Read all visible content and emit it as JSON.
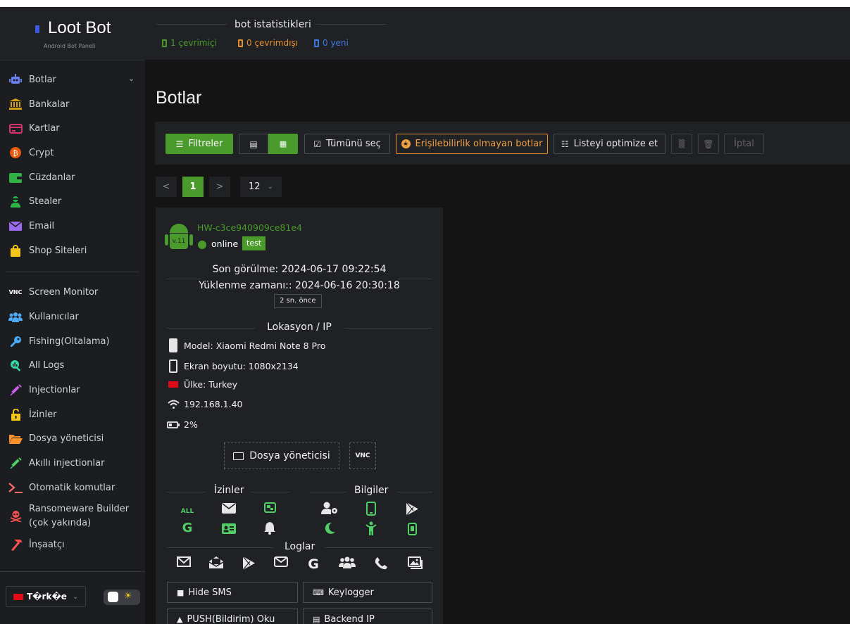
{
  "brand": {
    "name": "Loot Bot",
    "subtitle": "Android Bot Paneli"
  },
  "sidebar": {
    "items": [
      {
        "label": "Botlar",
        "icon": "robot-icon",
        "color": "#6a7ff0"
      },
      {
        "label": "Bankalar",
        "icon": "bank-icon",
        "color": "#d4a017"
      },
      {
        "label": "Kartlar",
        "icon": "credit-card-icon",
        "color": "#d6336c"
      },
      {
        "label": "Crypt",
        "icon": "bitcoin-icon",
        "color": "#e8590c"
      },
      {
        "label": "Cüzdanlar",
        "icon": "wallet-icon",
        "color": "#2fb344"
      },
      {
        "label": "Stealer",
        "icon": "user-secret-icon",
        "color": "#2fb344"
      },
      {
        "label": "Email",
        "icon": "envelope-icon",
        "color": "#9b6bf0"
      },
      {
        "label": "Shop Siteleri",
        "icon": "shopping-bag-icon",
        "color": "#f5c518"
      },
      {
        "label": "Screen Monitor",
        "icon": "vnc-icon",
        "color": "#ffffff"
      },
      {
        "label": "Kullanıcılar",
        "icon": "users-icon",
        "color": "#4dabf7"
      },
      {
        "label": "Fishing(Oltalama)",
        "icon": "key-icon",
        "color": "#4dabf7"
      },
      {
        "label": "All Logs",
        "icon": "search-chart-icon",
        "color": "#38d9a9"
      },
      {
        "label": "Injectionlar",
        "icon": "syringe-icon",
        "color": "#cc5de8"
      },
      {
        "label": "İzinler",
        "icon": "unlock-icon",
        "color": "#f5c518"
      },
      {
        "label": "Dosya yöneticisi",
        "icon": "folder-open-icon",
        "color": "#ff922b"
      },
      {
        "label": "Akıllı injectionlar",
        "icon": "syringe-icon",
        "color": "#51cf66"
      },
      {
        "label": "Otomatik komutlar",
        "icon": "terminal-icon",
        "color": "#ff6b6b"
      },
      {
        "label": "Ransomeware Builder (çok yakında)",
        "icon": "skull-icon",
        "color": "#fa5252"
      },
      {
        "label": "İnşaatçı",
        "icon": "hammer-icon",
        "color": "#fa5252"
      }
    ],
    "language": "T�rk�e",
    "accent": "#4a9a2c"
  },
  "header": {
    "stats_title": "bot istatistikleri",
    "online": "1 çevrimiçi",
    "offline": "0 çevrimdışı",
    "new": "0 yeni",
    "online_color": "#4a9a2c",
    "offline_color": "#e8902a",
    "new_color": "#3d7be0"
  },
  "main": {
    "title": "Botlar",
    "toolbar": {
      "filters": "Filtreler",
      "select_all": "Tümünü seç",
      "no_accessibility": "Erişilebilirlik olmayan botlar",
      "optimize": "Listeyi optimize et",
      "cancel": "İptal"
    },
    "pager": {
      "prev": "<",
      "page": "1",
      "next": ">",
      "per_page": "12"
    }
  },
  "card": {
    "hwid": "HW-c3ce940909ce81e4",
    "android_version": "v.11",
    "status": "online",
    "tag": "test",
    "last_seen": "Son görülme: 2024-06-17 09:22:54",
    "installed": "Yüklenme zamanı:: 2024-06-16 20:30:18",
    "ago": "2 sn. önce",
    "location_title": "Lokasyon / IP",
    "model": "Model: Xiaomi Redmi Note 8 Pro",
    "screen": "Ekran boyutu: 1080x2134",
    "country": "Ülke: Turkey",
    "ip": "192.168.1.40",
    "battery": "2%",
    "file_manager": "Dosya yöneticisi",
    "vnc": "VNC",
    "permissions_title": "İzinler",
    "info_title": "Bilgiler",
    "logs_title": "Loglar",
    "perm_all": "ALL",
    "actions": {
      "hide_sms": "Hide SMS",
      "keylogger": "Keylogger",
      "push": "PUSH(Bildirim) Oku",
      "backend": "Backend IP"
    }
  }
}
